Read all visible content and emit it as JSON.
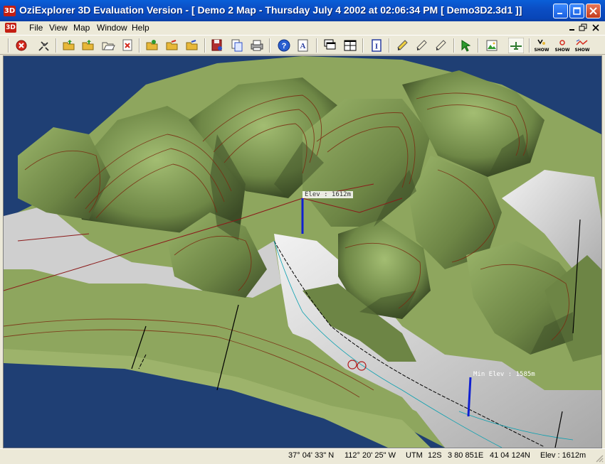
{
  "window": {
    "title": "OziExplorer 3D Evaluation Version - [ Demo 2 Map - Thursday July 4 2002  at  02:06:34 PM  [ Demo3D2.3d1 ]]",
    "app_icon": "3D"
  },
  "menu": {
    "doc_icon": "3D",
    "items": [
      "File",
      "View",
      "Map",
      "Window",
      "Help"
    ]
  },
  "toolbar": {
    "icons": [
      "exit-icon",
      "satellite-icon",
      "open-folder-icon",
      "open-folder-icon",
      "open-folder-icon",
      "close-doc-icon",
      "open-folder-icon",
      "open-folder-icon",
      "open-folder-icon",
      "save-icon",
      "copy-icon",
      "print-icon",
      "help-icon",
      "text-icon",
      "tile-icon",
      "grid-icon",
      "info-icon",
      "draw-icon",
      "draw-icon",
      "draw-icon",
      "arrow-icon",
      "image-icon",
      "plane-icon",
      "show-icon",
      "show-icon",
      "show-icon"
    ],
    "show_label": "SHOW"
  },
  "map": {
    "max_elev_label": "Elev : 1612m",
    "min_elev_label": "Min Elev : 1585m",
    "colors": {
      "water": "#1f3f74",
      "terrain": "#8ea65e",
      "snow": "#dcdcdc",
      "contour": "#7a2a10"
    }
  },
  "statusbar": {
    "lat": "37° 04' 33\" N",
    "lon": "112° 20' 25\" W",
    "utm_label": "UTM",
    "utm_zone": "12S",
    "easting": "3 80 851E",
    "northing": "41 04 124N",
    "elev": "Elev : 1612m"
  }
}
